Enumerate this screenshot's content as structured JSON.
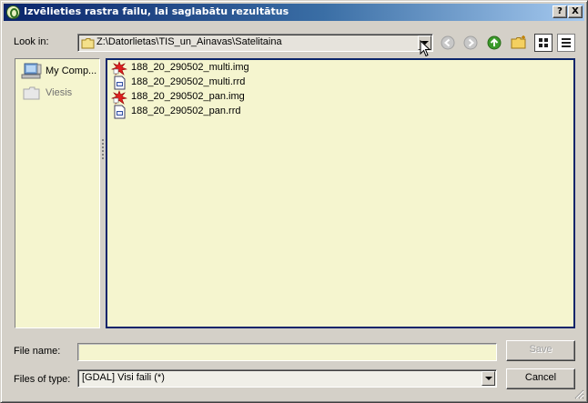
{
  "window": {
    "title": "Izvēlieties rastra failu, lai saglabātu rezultātus",
    "controls": {
      "help_label": "?",
      "close_label": "X"
    }
  },
  "look_in": {
    "label": "Look in:",
    "path": "Z:\\Datorlietas\\TIS_un_Ainavas\\Satelitaina"
  },
  "toolbar": {
    "icons": [
      "back-icon",
      "forward-icon",
      "parent-directory-icon",
      "new-folder-icon",
      "list-view-icon",
      "detail-view-icon"
    ]
  },
  "sidebar": {
    "items": [
      {
        "label": "My Comp...",
        "icon": "computer-icon"
      },
      {
        "label": "Viesis",
        "icon": "folder-icon"
      }
    ]
  },
  "files": [
    {
      "name": "188_20_290502_multi.img",
      "icon": "raster-image-icon"
    },
    {
      "name": "188_20_290502_multi.rrd",
      "icon": "rrd-file-icon"
    },
    {
      "name": "188_20_290502_pan.img",
      "icon": "raster-image-icon"
    },
    {
      "name": "188_20_290502_pan.rrd",
      "icon": "rrd-file-icon"
    }
  ],
  "file_name": {
    "label": "File name:",
    "value": ""
  },
  "file_type": {
    "label": "Files of type:",
    "value": "[GDAL] Visi faili (*)"
  },
  "buttons": {
    "save": "Save",
    "cancel": "Cancel"
  },
  "colors": {
    "accent": "#0a246a",
    "list_bg": "#f5f5cf",
    "dialog_bg": "#d4d0c8"
  }
}
